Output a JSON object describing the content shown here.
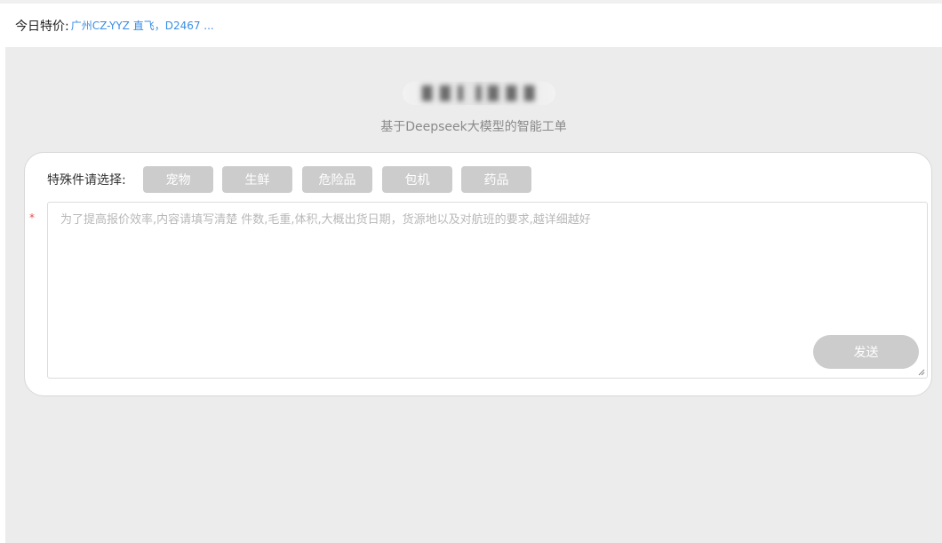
{
  "notice": {
    "label": "今日特价:",
    "link": "广州CZ-YYZ 直飞，D2467 ..."
  },
  "brand": {
    "logo_text": "█ █ ▌  ▌█ █ █",
    "subtitle": "基于Deepseek大模型的智能工单"
  },
  "form": {
    "special_label": "特殊件请选择:",
    "tags": [
      "宠物",
      "生鲜",
      "危险品",
      "包机",
      "药品"
    ],
    "required_mark": "*",
    "placeholder": "为了提高报价效率,内容请填写清楚 件数,毛重,体积,大概出货日期，货源地以及对航班的要求,越详细越好",
    "send_label": "发送"
  },
  "colors": {
    "background": "#ececec",
    "link": "#3a8ee6",
    "tag": "#cccccc",
    "required": "#e65050"
  }
}
